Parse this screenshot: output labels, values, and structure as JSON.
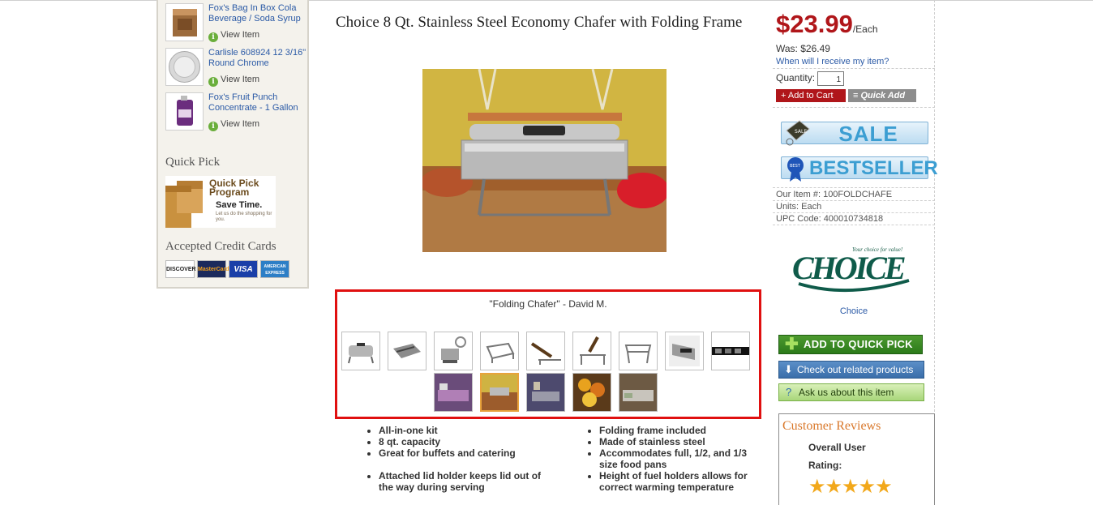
{
  "sidebar": {
    "recently_viewed": [
      {
        "title": "Fox's Bag In Box Cola Beverage / Soda Syrup",
        "link": "View Item"
      },
      {
        "title": "Carlisle 608924 12 3/16\" Round Chrome",
        "link": "View Item"
      },
      {
        "title": "Fox's Fruit Punch Concentrate - 1 Gallon",
        "link": "View Item"
      }
    ],
    "quick_pick_heading": "Quick Pick",
    "quick_pick_banner": {
      "title": "Quick Pick Program",
      "subtitle": "Save Time.",
      "tagline": "Let us do the shopping for you."
    },
    "credit_cards_heading": "Accepted Credit Cards",
    "cards": [
      "DISCOVER",
      "MasterCard",
      "VISA",
      "AMERICAN EXPRESS"
    ]
  },
  "product": {
    "title": "Choice 8 Qt. Stainless Steel Economy Chafer with Folding Frame",
    "gallery_caption": "\"Folding Chafer\" - David M.",
    "bullets_left": [
      "All-in-one kit",
      "8 qt. capacity",
      "Great for buffets and catering",
      "Attached lid holder keeps lid out of the way during serving"
    ],
    "bullets_right": [
      "Folding frame included",
      "Made of stainless steel",
      "Accommodates full, 1/2, and 1/3 size food pans",
      "Height of fuel holders allows for correct warming temperature"
    ]
  },
  "purchase": {
    "price": "$23.99",
    "price_unit": "/Each",
    "was": "Was: $26.49",
    "when_link": "When will I receive my item?",
    "quantity_label": "Quantity:",
    "quantity_value": "1",
    "add_to_cart": "Add to Cart",
    "quick_add": "Quick Add",
    "badges": {
      "sale": "SALE",
      "bestseller": "BESTSELLER",
      "sale_tag": "SALE",
      "best_tag": "BEST"
    },
    "item_no": "Our Item #: 100FOLDCHAFE",
    "units": "Units: Each",
    "upc": "UPC Code: 400010734818",
    "brand_logo_text": "CHOICE",
    "brand_tagline": "Your choice for value!",
    "brand_link": "Choice",
    "add_quick_pick": "ADD TO QUICK PICK",
    "related": "Check out related products",
    "ask": "Ask us about this item"
  },
  "reviews": {
    "title": "Customer Reviews",
    "line1": "Overall User",
    "line2": "Rating:",
    "stars": "★★★★★",
    "rating": 5
  },
  "colors": {
    "price_red": "#b0161a",
    "link_blue": "#2b5aa6",
    "gallery_border": "#e01010",
    "review_orange": "#d9782b"
  }
}
